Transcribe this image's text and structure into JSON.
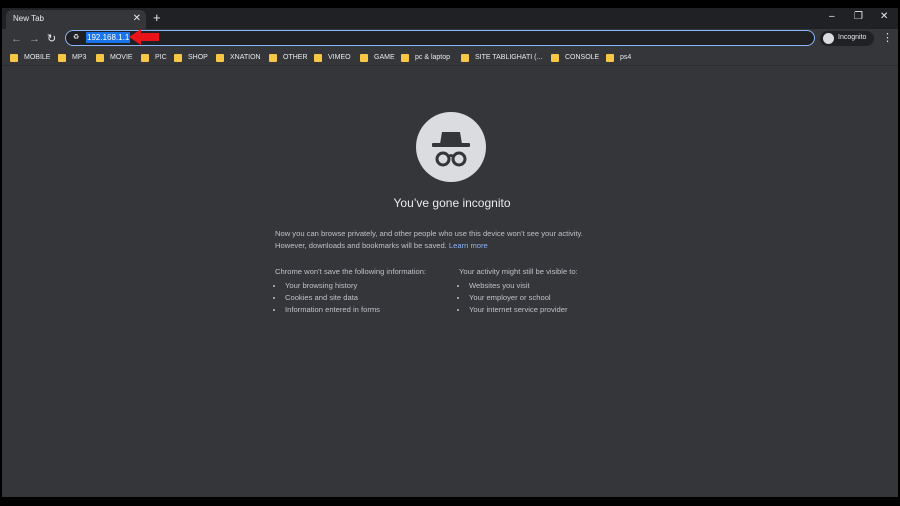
{
  "tab": {
    "title": "New Tab",
    "close_icon": "close-icon"
  },
  "new_tab_icon": "plus-icon",
  "window_controls": {
    "minimize": "minimize-icon",
    "restore": "restore-icon",
    "close": "close-icon"
  },
  "toolbar": {
    "back_icon": "arrow-left-icon",
    "forward_icon": "arrow-right-icon",
    "reload_icon": "reload-icon",
    "url": "192.168.1.1",
    "profile_label": "Incognito",
    "menu_icon": "more-vert-icon"
  },
  "annotation": {
    "arrow_color": "#e8141a"
  },
  "bookmarks": [
    {
      "label": "MOBILE"
    },
    {
      "label": "MP3"
    },
    {
      "label": "MOVIE"
    },
    {
      "label": "PIC"
    },
    {
      "label": "SHOP"
    },
    {
      "label": "XNATION"
    },
    {
      "label": "OTHER"
    },
    {
      "label": "VIMEO"
    },
    {
      "label": "GAME"
    },
    {
      "label": "pc & laptop"
    },
    {
      "label": "SITE TABLIGHATI (..."
    },
    {
      "label": "CONSOLE"
    },
    {
      "label": "ps4"
    }
  ],
  "content": {
    "heading": "You’ve gone incognito",
    "intro_line1": "Now you can browse privately, and other people who use this device won’t see your activity.",
    "intro_line2": "However, downloads and bookmarks will be saved.",
    "learn_more": "Learn more",
    "left_title": "Chrome won’t save the following information:",
    "left_items": [
      "Your browsing history",
      "Cookies and site data",
      "Information entered in forms"
    ],
    "right_title": "Your activity might still be visible to:",
    "right_items": [
      "Websites you visit",
      "Your employer or school",
      "Your internet service provider"
    ]
  },
  "colors": {
    "frame": "#202124",
    "page_bg": "#35363a",
    "accent": "#8ab4f8",
    "selection": "#1a73e8",
    "folder": "#f6c644"
  }
}
